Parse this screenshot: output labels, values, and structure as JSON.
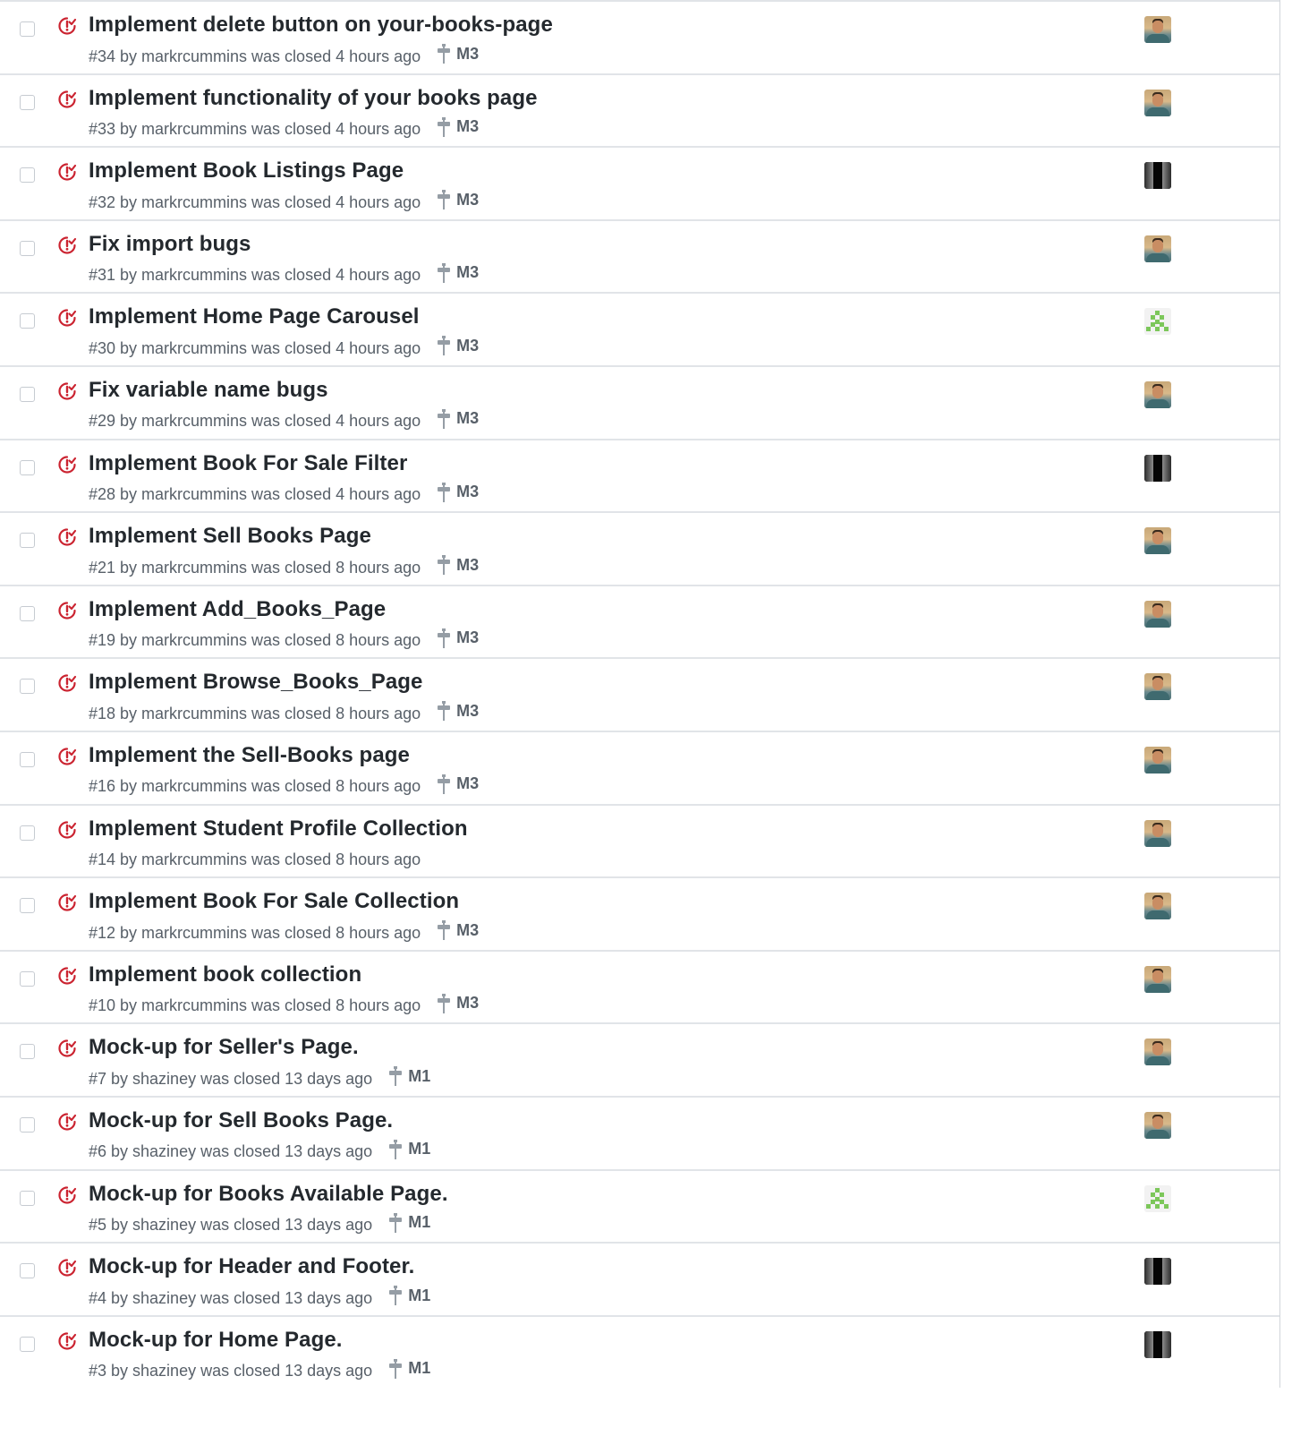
{
  "colors": {
    "closed_icon": "#cb2431",
    "text": "#24292e",
    "muted": "#586069",
    "divider": "#e1e4e8"
  },
  "icons": {
    "state": "issue-closed-icon",
    "milestone": "milestone-icon",
    "checkbox": "checkbox"
  },
  "issues": [
    {
      "title": "Implement delete button on your-books-page",
      "meta": "#34 by markrcummins was closed 4 hours ago",
      "milestone": "M3",
      "avatar": "man"
    },
    {
      "title": "Implement functionality of your books page",
      "meta": "#33 by markrcummins was closed 4 hours ago",
      "milestone": "M3",
      "avatar": "man"
    },
    {
      "title": "Implement Book Listings Page",
      "meta": "#32 by markrcummins was closed 4 hours ago",
      "milestone": "M3",
      "avatar": "dark"
    },
    {
      "title": "Fix import bugs",
      "meta": "#31 by markrcummins was closed 4 hours ago",
      "milestone": "M3",
      "avatar": "man"
    },
    {
      "title": "Implement Home Page Carousel",
      "meta": "#30 by markrcummins was closed 4 hours ago",
      "milestone": "M3",
      "avatar": "identicon"
    },
    {
      "title": "Fix variable name bugs",
      "meta": "#29 by markrcummins was closed 4 hours ago",
      "milestone": "M3",
      "avatar": "man"
    },
    {
      "title": "Implement Book For Sale Filter",
      "meta": "#28 by markrcummins was closed 4 hours ago",
      "milestone": "M3",
      "avatar": "dark"
    },
    {
      "title": "Implement Sell Books Page",
      "meta": "#21 by markrcummins was closed 8 hours ago",
      "milestone": "M3",
      "avatar": "man"
    },
    {
      "title": "Implement Add_Books_Page",
      "meta": "#19 by markrcummins was closed 8 hours ago",
      "milestone": "M3",
      "avatar": "man"
    },
    {
      "title": "Implement Browse_Books_Page",
      "meta": "#18 by markrcummins was closed 8 hours ago",
      "milestone": "M3",
      "avatar": "man"
    },
    {
      "title": "Implement the Sell-Books page",
      "meta": "#16 by markrcummins was closed 8 hours ago",
      "milestone": "M3",
      "avatar": "man"
    },
    {
      "title": "Implement Student Profile Collection",
      "meta": "#14 by markrcummins was closed 8 hours ago",
      "milestone": "",
      "avatar": "man"
    },
    {
      "title": "Implement Book For Sale Collection",
      "meta": "#12 by markrcummins was closed 8 hours ago",
      "milestone": "M3",
      "avatar": "man"
    },
    {
      "title": "Implement book collection",
      "meta": "#10 by markrcummins was closed 8 hours ago",
      "milestone": "M3",
      "avatar": "man"
    },
    {
      "title": "Mock-up for Seller's Page.",
      "meta": "#7 by shaziney was closed 13 days ago",
      "milestone": "M1",
      "avatar": "man"
    },
    {
      "title": "Mock-up for Sell Books Page.",
      "meta": "#6 by shaziney was closed 13 days ago",
      "milestone": "M1",
      "avatar": "man"
    },
    {
      "title": "Mock-up for Books Available Page.",
      "meta": "#5 by shaziney was closed 13 days ago",
      "milestone": "M1",
      "avatar": "identicon"
    },
    {
      "title": "Mock-up for Header and Footer.",
      "meta": "#4 by shaziney was closed 13 days ago",
      "milestone": "M1",
      "avatar": "dark"
    },
    {
      "title": "Mock-up for Home Page.",
      "meta": "#3 by shaziney was closed 13 days ago",
      "milestone": "M1",
      "avatar": "dark"
    }
  ]
}
